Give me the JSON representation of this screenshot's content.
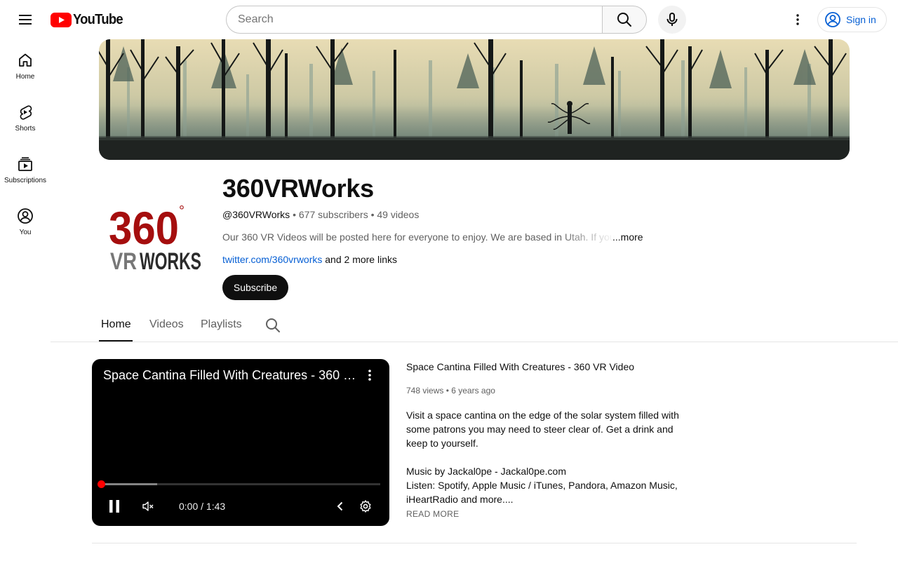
{
  "header": {
    "logo_text": "YouTube",
    "search_placeholder": "Search",
    "sign_in_label": "Sign in"
  },
  "sidebar": {
    "items": [
      {
        "label": "Home",
        "icon": "home-icon"
      },
      {
        "label": "Shorts",
        "icon": "shorts-icon"
      },
      {
        "label": "Subscriptions",
        "icon": "subscriptions-icon"
      },
      {
        "label": "You",
        "icon": "you-icon"
      }
    ]
  },
  "channel": {
    "name": "360VRWorks",
    "handle": "@360VRWorks",
    "subscribers": "677 subscribers",
    "videos": "49 videos",
    "separator": " • ",
    "description": "Our 360 VR Videos will be posted here for everyone to enjoy. We are based in Utah. If you",
    "more_label": "...more",
    "link_text": "twitter.com/360vrworks",
    "more_links": "and 2 more links",
    "subscribe_label": "Subscribe",
    "avatar_text_top": "360",
    "avatar_degree": "°",
    "avatar_text_bottom_left": "VR",
    "avatar_text_bottom_right": "WORKS"
  },
  "tabs": [
    {
      "label": "Home",
      "active": true
    },
    {
      "label": "Videos",
      "active": false
    },
    {
      "label": "Playlists",
      "active": false
    }
  ],
  "featured": {
    "player_title": "Space Cantina Filled With Creatures - 360 VR Video",
    "time": "0:00 / 1:43",
    "progress_played_fraction": 0.0,
    "progress_loaded_fraction": 0.2,
    "title": "Space Cantina Filled With Creatures - 360 VR Video",
    "views": "748 views",
    "age": "6 years ago",
    "description_paragraphs": [
      "Visit a space cantina on the edge of the solar system filled with some patrons you may need to steer clear of. Get a drink and keep to yourself.",
      "",
      "Music by Jackal0pe - Jackal0pe.com",
      "Listen: Spotify, Apple Music / iTunes, Pandora, Amazon Music, iHeartRadio and more...."
    ],
    "read_more_label": "READ MORE"
  },
  "colors": {
    "brand_red": "#FF0000",
    "link_blue": "#065fd4",
    "avatar_red": "#a50e0e",
    "avatar_dark": "#2b2b2b"
  }
}
